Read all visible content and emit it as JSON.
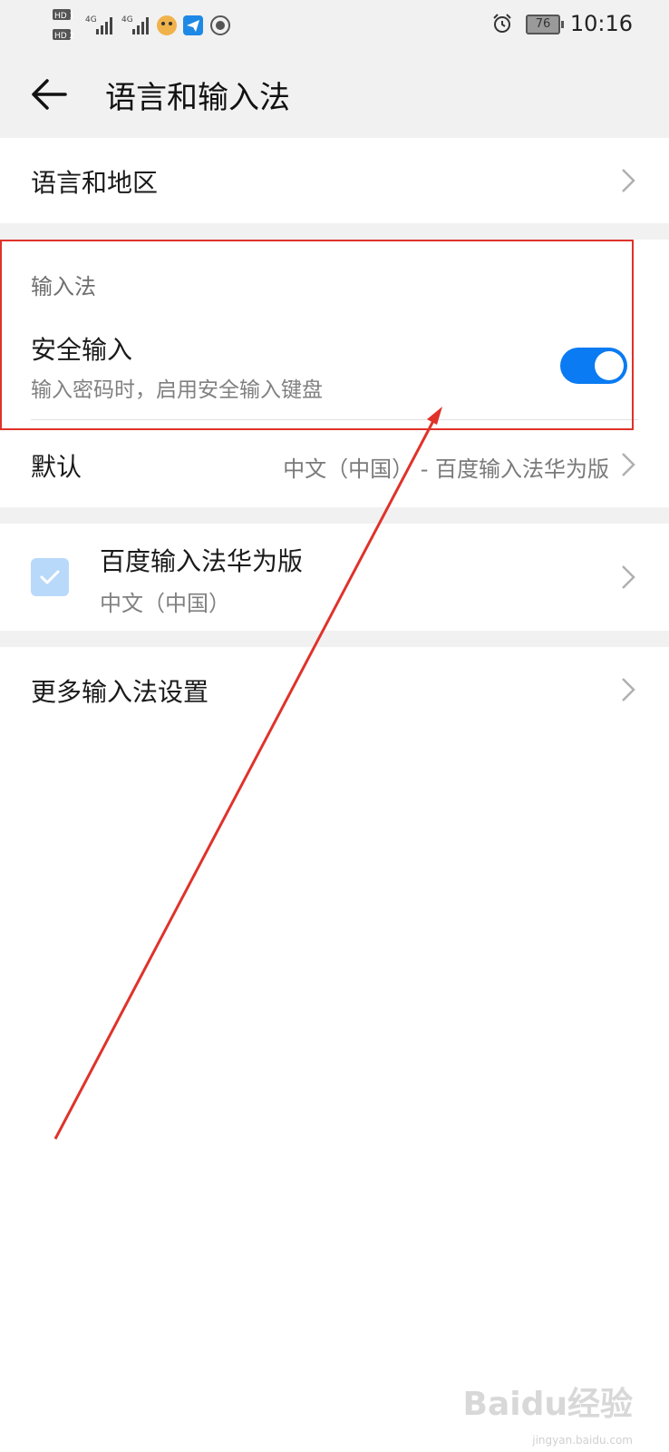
{
  "status_bar": {
    "time": "10:16",
    "battery": "76",
    "network_1": "4G",
    "network_2": "4G",
    "sim_1": "HD 1",
    "sim_2": "HD 2",
    "icons": [
      "signal-icon",
      "mascot-app-icon",
      "send-app-icon",
      "settings-app-icon",
      "alarm-icon",
      "battery-icon"
    ]
  },
  "header": {
    "title": "语言和输入法"
  },
  "rows": {
    "language_region": {
      "label": "语言和地区"
    },
    "input_section_label": "输入法",
    "secure_input": {
      "label": "安全输入",
      "description": "输入密码时，启用安全输入键盘",
      "enabled": true
    },
    "default": {
      "label": "默认",
      "value": "中文（中国） - 百度输入法华为版"
    },
    "baidu": {
      "label": "百度输入法华为版",
      "sub": "中文（中国）",
      "checked": true
    },
    "more_settings": {
      "label": "更多输入法设置"
    }
  },
  "watermark": {
    "text": "Baidu经验",
    "url": "jingyan.baidu.com"
  },
  "colors": {
    "accent": "#0a7bf2",
    "annotation": "#e0322a",
    "background_gray": "#f1f1f1"
  }
}
